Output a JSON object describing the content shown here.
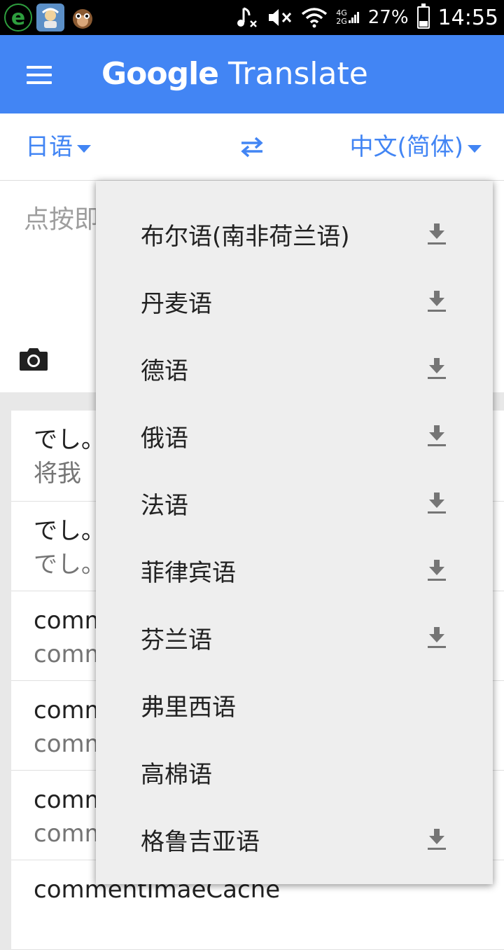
{
  "status_bar": {
    "network_top": "4G",
    "network_bottom": "2G",
    "battery": "27%",
    "battery_level": 0.27,
    "time": "14:55"
  },
  "appbar": {
    "brand": "Google",
    "title": "Translate"
  },
  "languages": {
    "source": "日语",
    "target": "中文(简体)"
  },
  "input": {
    "hint": "点按即"
  },
  "history": [
    {
      "source": "でし。",
      "translation": "将我"
    },
    {
      "source": "でし。",
      "translation": "でし。"
    },
    {
      "source": "comm",
      "translation": "comm"
    },
    {
      "source": "comm",
      "translation": "comm"
    },
    {
      "source": "comm",
      "translation": "comm"
    },
    {
      "source": "commentImaeCache",
      "translation": ""
    }
  ],
  "dropdown": {
    "items": [
      {
        "label": "布尔语(南非荷兰语)",
        "downloadable": true
      },
      {
        "label": "丹麦语",
        "downloadable": true
      },
      {
        "label": "德语",
        "downloadable": true
      },
      {
        "label": "俄语",
        "downloadable": true
      },
      {
        "label": "法语",
        "downloadable": true
      },
      {
        "label": "菲律宾语",
        "downloadable": true
      },
      {
        "label": "芬兰语",
        "downloadable": true
      },
      {
        "label": "弗里西语",
        "downloadable": false
      },
      {
        "label": "高棉语",
        "downloadable": false
      },
      {
        "label": "格鲁吉亚语",
        "downloadable": true
      }
    ]
  },
  "colors": {
    "accent": "#4285f4",
    "dropdown_bg": "#eeeeee",
    "icon_gray": "#757575"
  }
}
